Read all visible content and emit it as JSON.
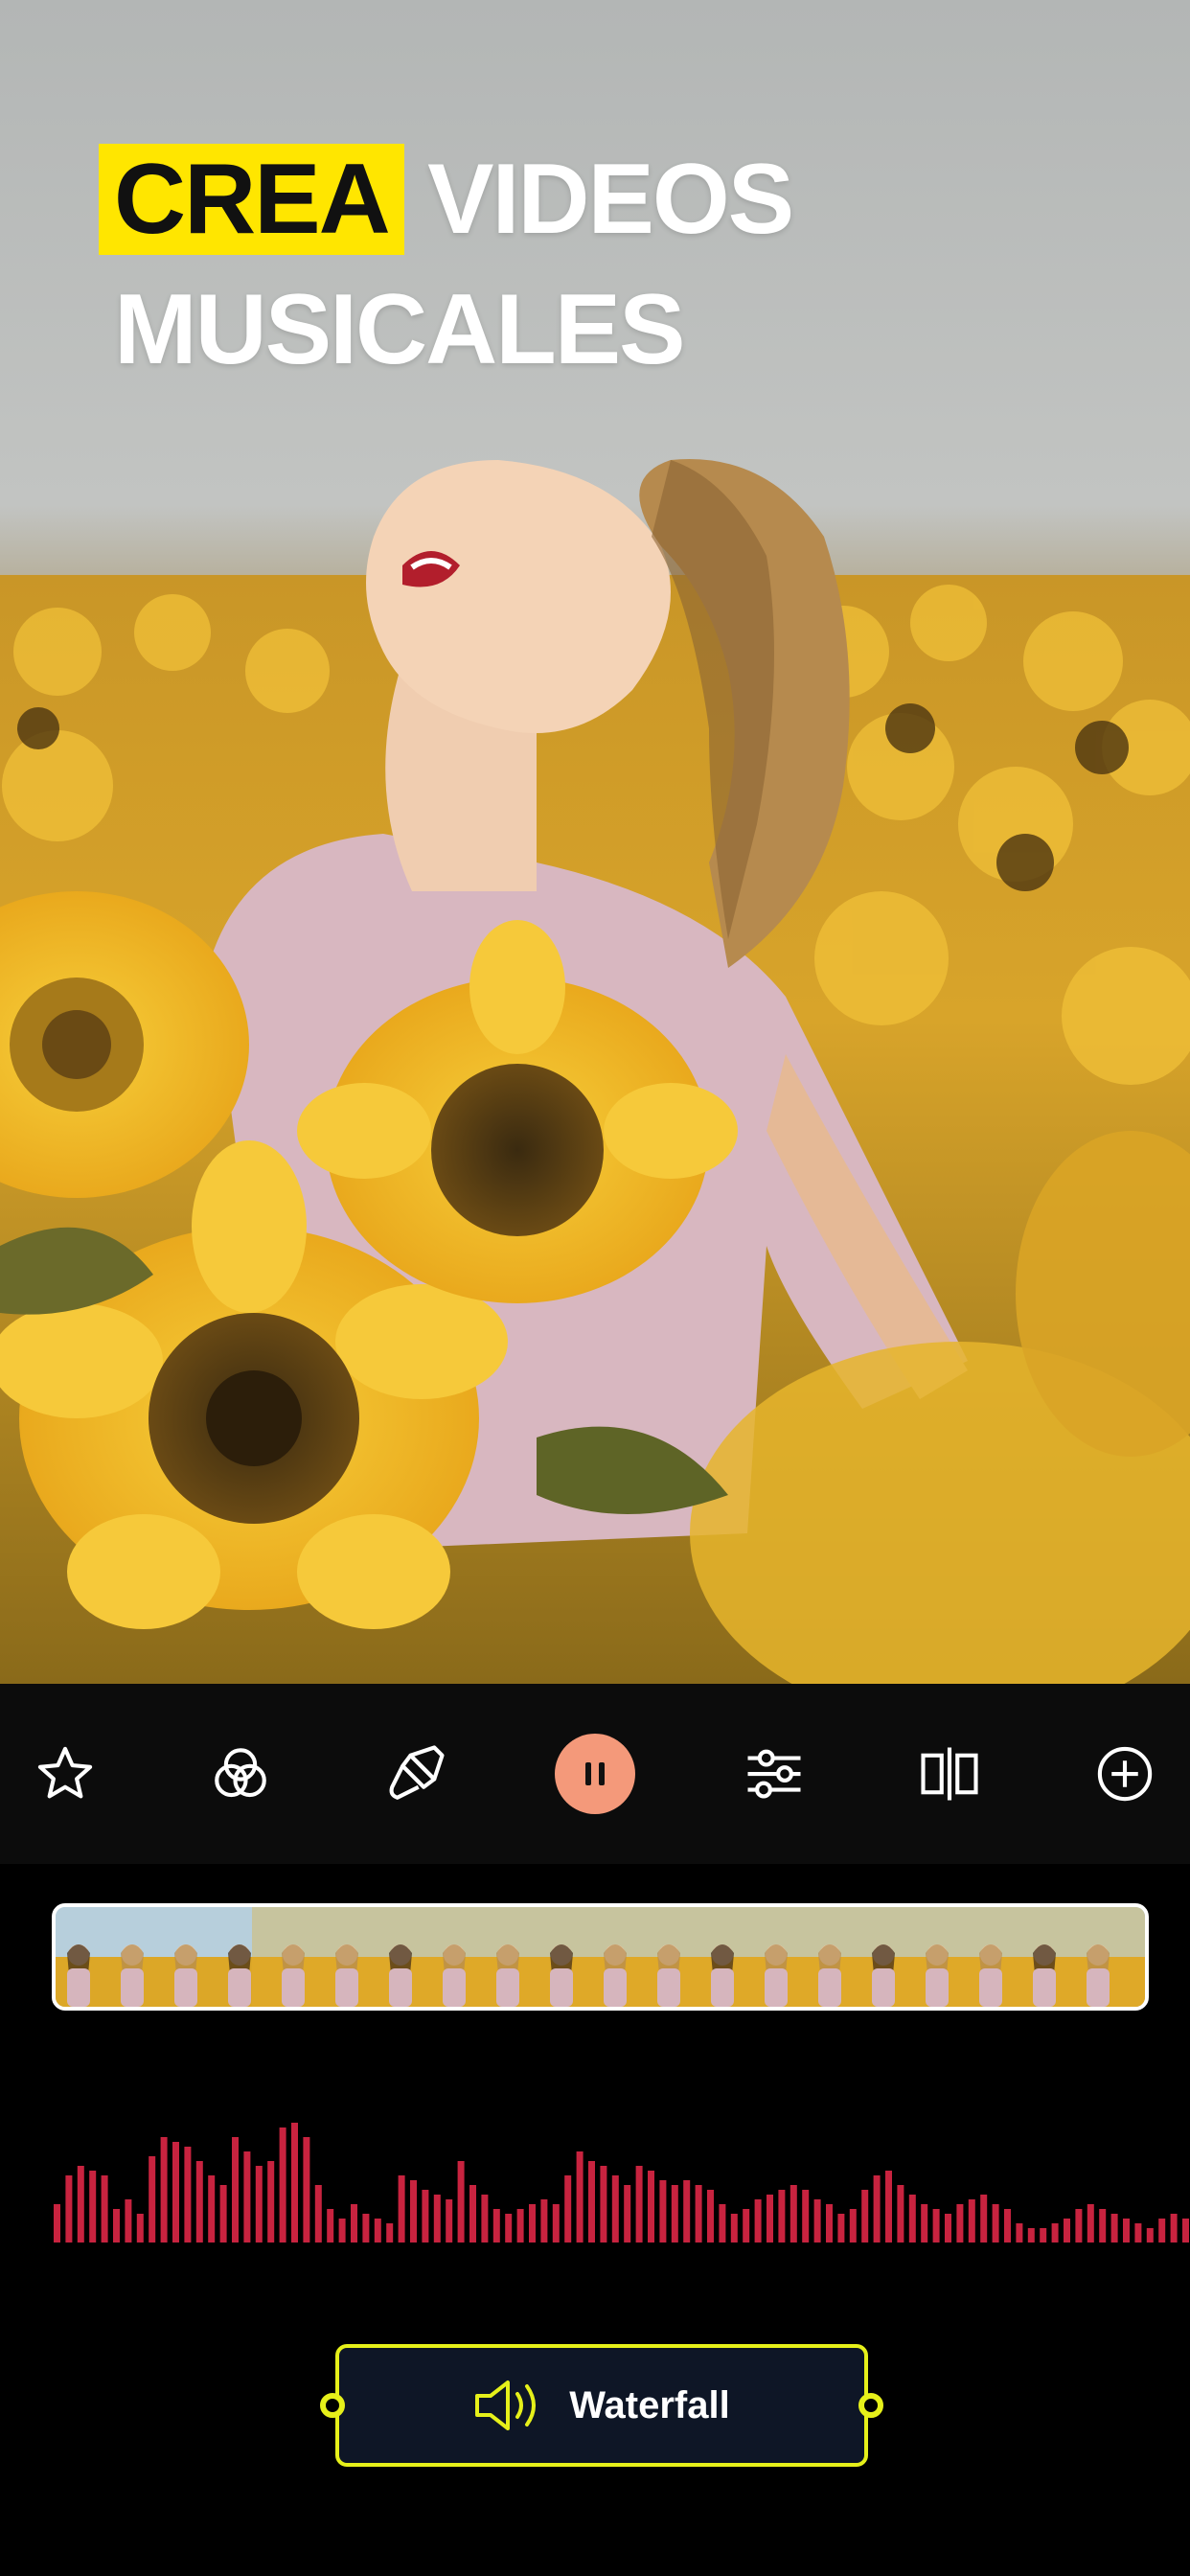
{
  "headline": {
    "highlight": "CREA",
    "line1_rest": "VIDEOS",
    "line2": "MUSICALES"
  },
  "toolbar": {
    "tools": [
      {
        "name": "star-icon"
      },
      {
        "name": "filters-icon"
      },
      {
        "name": "brush-icon"
      },
      {
        "name": "pause-icon"
      },
      {
        "name": "sliders-icon"
      },
      {
        "name": "split-icon"
      },
      {
        "name": "add-icon"
      }
    ],
    "play_button_color": "#f4997a"
  },
  "audio": {
    "track_label": "Waterfall",
    "accent_color": "#e6f01a",
    "waveform_color": "#c8233f"
  }
}
